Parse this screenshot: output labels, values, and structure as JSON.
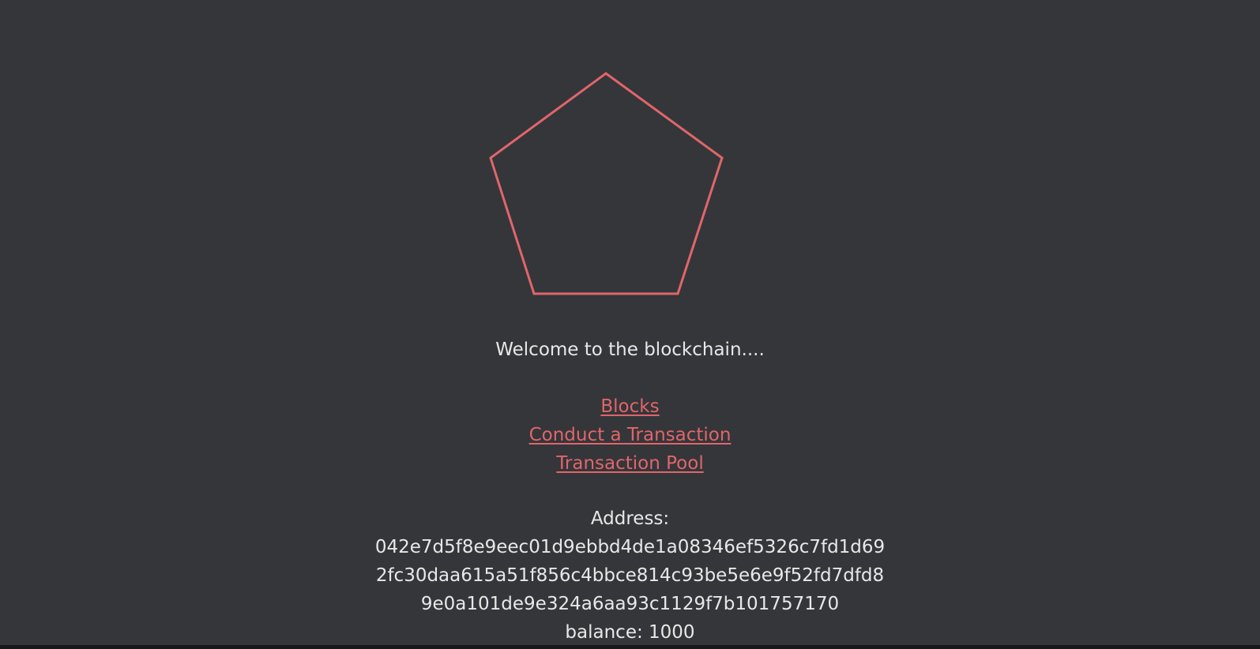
{
  "logo": {
    "icon": "pentagon-outline-icon",
    "stroke_color": "#e0666a"
  },
  "welcome_text": "Welcome to the blockchain....",
  "nav": {
    "blocks_label": "Blocks",
    "conduct_transaction_label": "Conduct a Transaction",
    "transaction_pool_label": "Transaction Pool",
    "link_color": "#e0666a"
  },
  "wallet": {
    "address_label": "Address:",
    "address_lines": [
      "042e7d5f8e9eec01d9ebbd4de1a08346ef5326c7fd1d69",
      "2fc30daa615a51f856c4bbce814c93be5e6e9f52fd7dfd8",
      "9e0a101de9e324a6aa93c1129f7b101757170"
    ],
    "balance_text": "balance: 1000"
  },
  "colors": {
    "background": "#34363a",
    "text": "#e8e8e8",
    "accent": "#e0666a"
  }
}
